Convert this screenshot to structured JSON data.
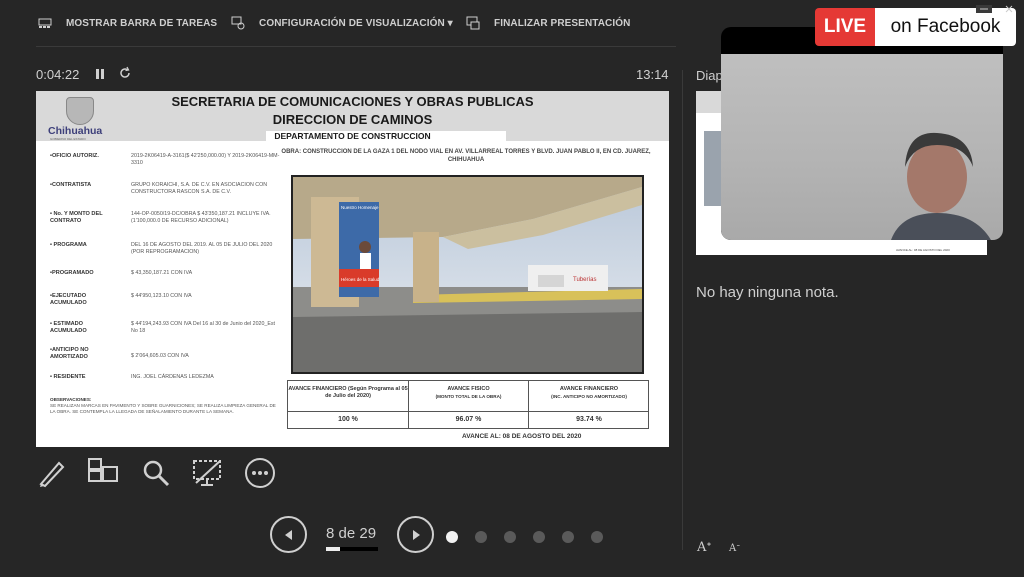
{
  "toolbar": {
    "taskbar_label": "MOSTRAR BARRA DE TAREAS",
    "display_label": "CONFIGURACIÓN DE VISUALIZACIÓN ▾",
    "end_label": "FINALIZAR PRESENTACIÓN"
  },
  "timer": {
    "elapsed": "0:04:22",
    "clock": "13:14"
  },
  "slide": {
    "logo_text": "Chihuahua",
    "logo_subtext": "GOBIERNO DEL ESTADO",
    "title1": "SECRETARIA DE COMUNICACIONES Y OBRAS PUBLICAS",
    "title2": "DIRECCION DE CAMINOS",
    "title3": "DEPARTAMENTO DE CONSTRUCCION",
    "obra": "OBRA: CONSTRUCCION DE LA GAZA 1 DEL NODO VIAL EN AV. VILLARREAL TORRES Y BLVD. JUAN PABLO II, EN CD. JUAREZ, CHIHUAHUA",
    "fields": [
      {
        "label": "•OFICIO AUTORIZ.",
        "value": "2019-2K06419-A-3161($ 42'250,000.00) Y 2019-2K06419-MM-3310"
      },
      {
        "label": "•CONTRATISTA",
        "value": "GRUPO KORAICHI, S.A. DE C.V. EN ASOCIACION CON CONSTRUCTORA RASCON S.A. DE C.V."
      },
      {
        "label": "• No. Y MONTO DEL CONTRATO",
        "value": "144-OP-0050/19-DC/OBRA  $ 43'350,187.21 INCLUYE IVA. (1'100,000.0 DE RECURSO ADICIONAL)"
      },
      {
        "label": "• PROGRAMA",
        "value": "DEL 16 DE AGOSTO DEL 2019. AL 05 DE JULIO DEL 2020 (POR REPROGRAMACION)"
      },
      {
        "label": "•PROGRAMADO",
        "value": "$ 43,350,187.21 CON IVA"
      },
      {
        "label": "•EJECUTADO ACUMULADO",
        "value": "$ 44'950,123.10 CON IVA"
      },
      {
        "label": "• ESTIMADO ACUMULADO",
        "value": "$ 44'194,243.93 CON IVA  Del 16 al 30 de Junio del 2020_Est No 18"
      },
      {
        "label": "•ANTICIPO NO AMORTIZADO",
        "value": "$ 2'064,605.03 CON IVA"
      },
      {
        "label": "• RESIDENTE",
        "value": "ING. JOEL CÁRDENAS LEDEZMA"
      }
    ],
    "obs_title": "OBSERVACIONES:",
    "obs_text": "SE REALIZAN MARCAS EN PAVIMENTO Y SOBRE GUARNICIONES; SE REALIZA LIMPIEZA GENERAL DE LA OBRA. SE CONTEMPLA LA LLEGADA DE SEÑALAMIENTO DURANTE LA SEMANA.",
    "billboard_lines": [
      "Nuestro Homenaje",
      "Héroes de la Salud"
    ],
    "table": {
      "h1": "AVANCE FINANCIERO (Según Programa al 05 de Julio del 2020)",
      "h2": "AVANCE FISICO",
      "h2_sub": "(MONTO TOTAL DE LA OBRA)",
      "h3": "AVANCE FINANCIERO",
      "h3_sub": "(INC. ANTICIPO NO AMORTIZADO)",
      "v1": "100 %",
      "v2": "96.07 %",
      "v3": "93.74 %"
    },
    "avance_al": "AVANCE AL: 08 DE AGOSTO DEL 2020"
  },
  "nav": {
    "counter": "8 de 29",
    "current": 8,
    "total": 29
  },
  "panel": {
    "title": "Diap",
    "notes": "No hay ninguna nota.",
    "next_slide_footer": "AVANCE AL: 08 DE AGOSTO DEL 2020"
  },
  "live": {
    "live_label": "LIVE",
    "platform_label": "on Facebook"
  },
  "colors": {
    "live_red": "#e53935",
    "background": "#262626"
  }
}
